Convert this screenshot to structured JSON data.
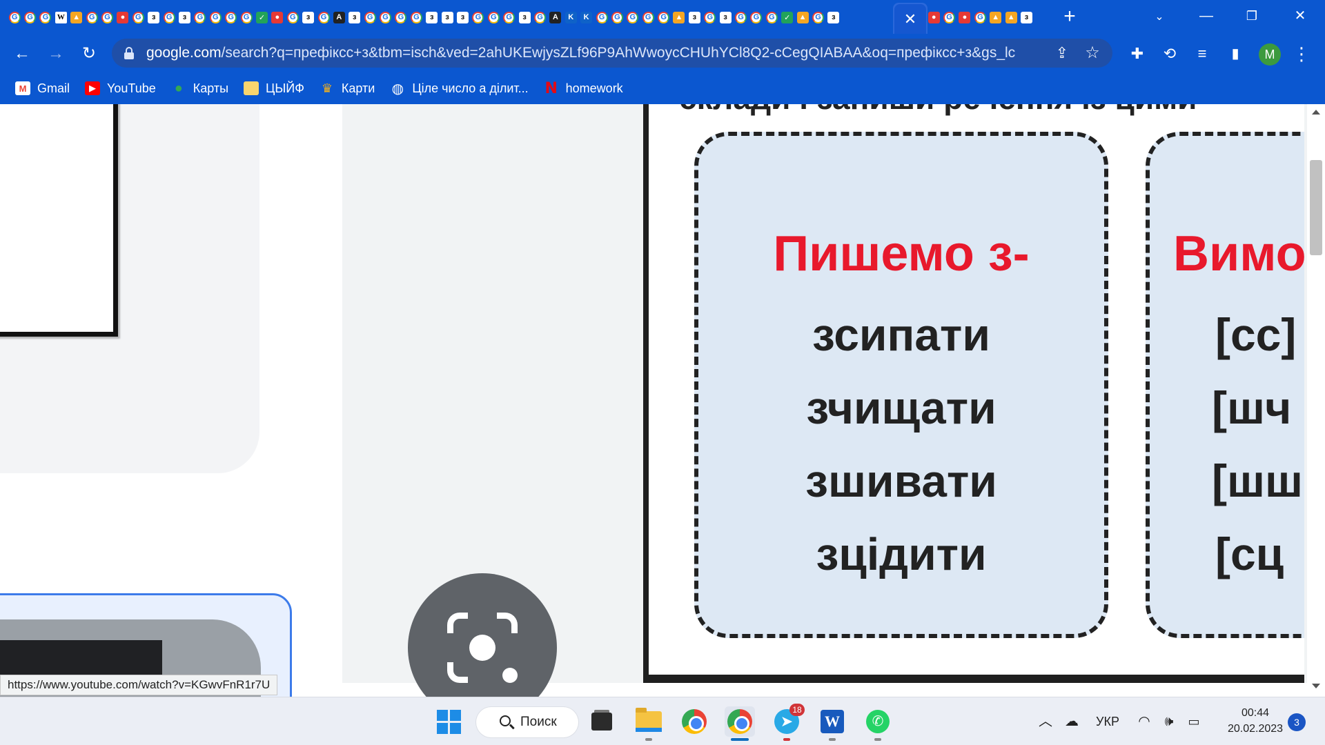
{
  "browser": {
    "tab_icons": [
      "G",
      "G",
      "G",
      "W",
      "Y",
      "G",
      "G",
      "R",
      "G",
      "З",
      "G",
      "З",
      "G",
      "G",
      "G",
      "G",
      "K",
      "R",
      "G",
      "З",
      "G",
      "D",
      "З",
      "G",
      "G",
      "G",
      "G",
      "З",
      "З",
      "З",
      "G",
      "G",
      "G",
      "З",
      "G",
      "D",
      "B",
      "B",
      "G",
      "G",
      "G",
      "G",
      "G",
      "Y",
      "З",
      "G",
      "З",
      "G",
      "G",
      "G",
      "K",
      "Y",
      "G",
      "З"
    ],
    "tab_icons_right": [
      "R",
      "G",
      "R",
      "G",
      "Y",
      "Y",
      "З"
    ],
    "active_tab_close": "✕",
    "new_tab": "+",
    "tab_search": "⌄",
    "window_controls": {
      "minimize": "—",
      "restore": "❐",
      "close": "✕"
    },
    "nav": {
      "back": "←",
      "forward": "→",
      "reload": "↻"
    },
    "url": {
      "domain": "google.com",
      "rest": "/search?q=префіксс+з&tbm=isch&ved=2ahUKEwjysZLf96P9AhWwoycCHUhYCl8Q2-cCegQIABAA&oq=префіксс+з&gs_lcp=..."
    },
    "share": "⇪",
    "star": "☆",
    "extensions": "✚",
    "media_icon": "≡",
    "sidebar_icon": "▮",
    "menu_icon": "⋮",
    "avatar_letter": "M",
    "bookmarks": [
      {
        "label": "Gmail",
        "icon": "gmail"
      },
      {
        "label": "YouTube",
        "icon": "youtube"
      },
      {
        "label": "Карты",
        "icon": "maps"
      },
      {
        "label": "ЦЫЙФ",
        "icon": "folder"
      },
      {
        "label": "Карти",
        "icon": "crown"
      },
      {
        "label": "Ціле число а ділит...",
        "icon": "globe"
      },
      {
        "label": "homework",
        "icon": "netflix"
      }
    ]
  },
  "content": {
    "doc_cutoff_text": "склади і запиши речення із цими",
    "box1": {
      "heading": "Пишемо з-",
      "words": [
        "зсипати",
        "зчищати",
        "зшивати",
        "зцідити"
      ]
    },
    "box2": {
      "heading": "Вимо",
      "words": [
        "[сс]",
        "[шч",
        "[шш",
        "[сц"
      ]
    },
    "status_url": "https://www.youtube.com/watch?v=KGwvFnR1r7U"
  },
  "taskbar": {
    "search_label": "Поиск",
    "telegram_badge": "18",
    "tray": {
      "chevron": "^",
      "language": "УКР",
      "wifi": "wifi-icon",
      "volume": "volume-icon",
      "battery": "battery-icon"
    },
    "time": "00:44",
    "date": "20.02.2023",
    "notifications": "3"
  },
  "colors": {
    "chrome_blue": "#0b57d0",
    "red_heading": "#e8192c",
    "box_fill": "#dde8f4"
  }
}
